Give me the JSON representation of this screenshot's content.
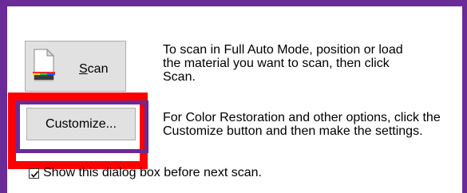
{
  "scan_button": {
    "label_underlined": "S",
    "label_rest": "can"
  },
  "scan_description": "To scan in Full Auto Mode, position or load\nthe material you want to scan, then click\nScan.",
  "customize_button": {
    "label": "Customize..."
  },
  "customize_description": "For Color Restoration and other options, click the\nCustomize button and then make the settings.",
  "show_dialog_checkbox": {
    "checked": true,
    "label": "Show this dialog box before next scan."
  },
  "colors": {
    "frame": "#6a2a97",
    "highlight": "#ff0000",
    "button_face": "#e1e1e1"
  }
}
